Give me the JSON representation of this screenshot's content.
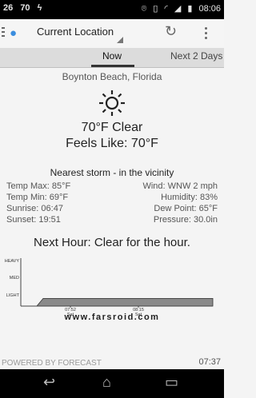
{
  "status": {
    "left": [
      "26",
      "70"
    ],
    "time": "08:06",
    "icons": [
      "usb-icon",
      "location-icon",
      "vibrate-icon",
      "wifi-icon",
      "signal-icon",
      "battery-icon"
    ]
  },
  "actionbar": {
    "location": "Current Location",
    "icons": [
      "menu-icon",
      "drop-icon",
      "refresh-icon",
      "overflow-icon"
    ]
  },
  "tabs": [
    {
      "label": "Now"
    },
    {
      "label": "Next 2 Days"
    }
  ],
  "current": {
    "city": "Boynton Beach, Florida",
    "condition": "70°F Clear",
    "feels": "Feels Like: 70°F",
    "storm": "Nearest storm - in the vicinity",
    "details": [
      {
        "left": "Temp Max: 85°F",
        "right": "Wind: WNW 2 mph"
      },
      {
        "left": "Temp Min: 69°F",
        "right": "Humidity: 83%"
      },
      {
        "left": "Sunrise: 06:47",
        "right": "Dew Point: 65°F"
      },
      {
        "left": "Sunset: 19:51",
        "right": "Pressure: 30.0in"
      }
    ]
  },
  "nexthour": "Next Hour: Clear for the hour.",
  "chart_data": {
    "type": "area",
    "yticks": [
      "HEAVY",
      "MED",
      "LIGHT"
    ],
    "xticks": [
      {
        "time": "07:52",
        "day": "Sat"
      },
      {
        "time": "08:15",
        "day": "Sat"
      }
    ],
    "x": [
      0,
      5,
      7,
      60
    ],
    "values": [
      0,
      0,
      0.8,
      0.8
    ]
  },
  "watermark": "www.farsroid.com",
  "footer": {
    "powered": "POWERED BY FORECAST",
    "time": "07:37"
  },
  "navbar": {
    "icons": [
      "back-icon",
      "home-icon",
      "recents-icon"
    ]
  }
}
